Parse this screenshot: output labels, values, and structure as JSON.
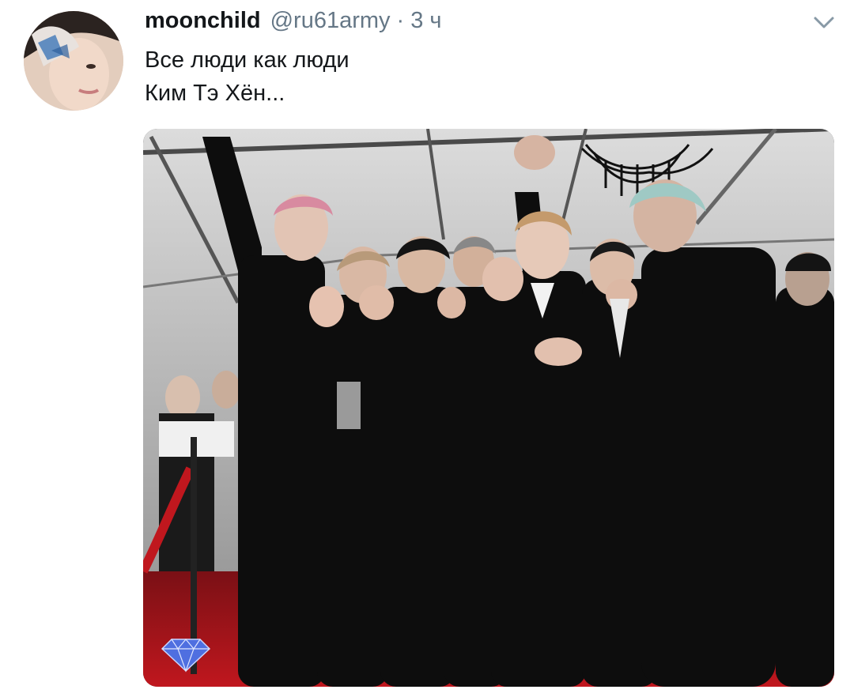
{
  "tweet": {
    "display_name": "moonchild",
    "handle": "@ru61army",
    "separator": "·",
    "time": "3 ч",
    "text_lines": [
      "Все люди как люди",
      "Ким Тэ Хён..."
    ],
    "media": {
      "watermark_icon": "diamond-icon"
    },
    "icons": {
      "more": "chevron-down-icon",
      "avatar": "avatar"
    }
  },
  "colors": {
    "name": "#14171a",
    "secondary": "#657786",
    "carpet": "#c0171e"
  }
}
